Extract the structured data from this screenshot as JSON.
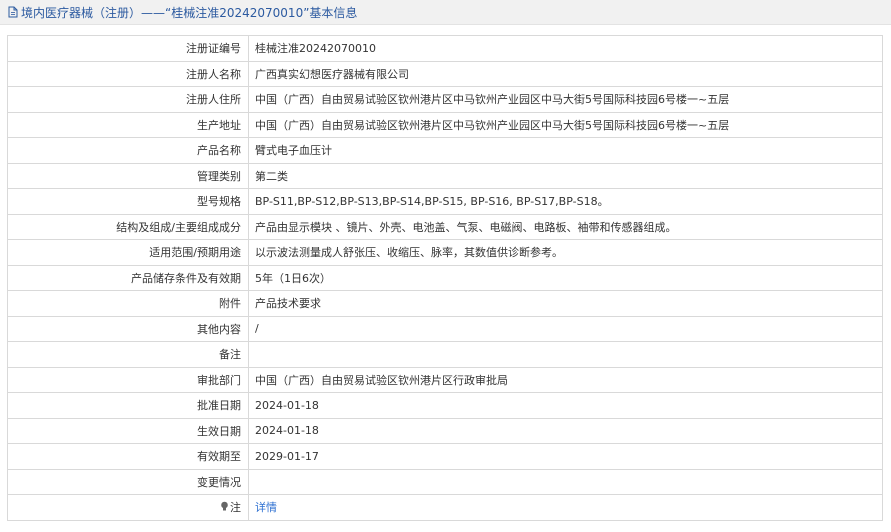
{
  "header": {
    "title": "境内医疗器械（注册）——“桂械注准20242070010”基本信息"
  },
  "rows": [
    {
      "label": "注册证编号",
      "value": "桂械注准20242070010"
    },
    {
      "label": "注册人名称",
      "value": "广西真实幻想医疗器械有限公司"
    },
    {
      "label": "注册人住所",
      "value": "中国（广西）自由贸易试验区钦州港片区中马钦州产业园区中马大街5号国际科技园6号楼一~五层"
    },
    {
      "label": "生产地址",
      "value": "中国（广西）自由贸易试验区钦州港片区中马钦州产业园区中马大街5号国际科技园6号楼一~五层"
    },
    {
      "label": "产品名称",
      "value": "臂式电子血压计"
    },
    {
      "label": "管理类别",
      "value": "第二类"
    },
    {
      "label": "型号规格",
      "value": "BP-S11,BP-S12,BP-S13,BP-S14,BP-S15, BP-S16, BP-S17,BP-S18。"
    },
    {
      "label": "结构及组成/主要组成成分",
      "value": "产品由显示模块 、镜片、外壳、电池盖、气泵、电磁阀、电路板、袖带和传感器组成。"
    },
    {
      "label": "适用范围/预期用途",
      "value": "以示波法测量成人舒张压、收缩压、脉率，其数值供诊断参考。"
    },
    {
      "label": "产品储存条件及有效期",
      "value": "5年（1日6次）"
    },
    {
      "label": "附件",
      "value": "产品技术要求"
    },
    {
      "label": "其他内容",
      "value": "/"
    },
    {
      "label": "备注",
      "value": ""
    },
    {
      "label": "审批部门",
      "value": "中国（广西）自由贸易试验区钦州港片区行政审批局"
    },
    {
      "label": "批准日期",
      "value": "2024-01-18"
    },
    {
      "label": "生效日期",
      "value": "2024-01-18"
    },
    {
      "label": "有效期至",
      "value": "2029-01-17"
    },
    {
      "label": "变更情况",
      "value": ""
    }
  ],
  "note": {
    "label": "注",
    "link_text": "详情",
    "icon": "lightbulb-icon"
  },
  "colors": {
    "title": "#2c5aa0",
    "link": "#2c6fd1",
    "border": "#d9d9d9",
    "header_bg": "#f1f1f1"
  }
}
